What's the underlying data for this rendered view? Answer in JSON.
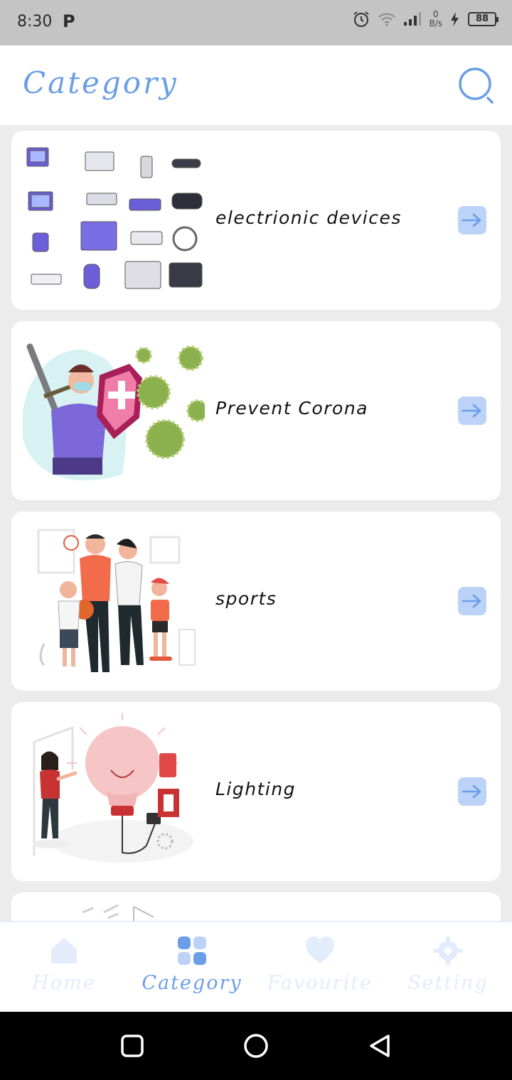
{
  "status_bar": {
    "time": "8:30",
    "app_glyph": "P",
    "net_speed_value": "0",
    "net_speed_unit": "B/s",
    "battery": "88"
  },
  "header": {
    "title": "Category",
    "search_icon": "search-icon"
  },
  "categories": [
    {
      "label": "electrionic devices",
      "illustration": "electronic-devices-illustration",
      "arrow_icon": "arrow-right-icon"
    },
    {
      "label": "Prevent Corona",
      "illustration": "prevent-corona-illustration",
      "arrow_icon": "arrow-right-icon"
    },
    {
      "label": "sports",
      "illustration": "sports-family-illustration",
      "arrow_icon": "arrow-right-icon"
    },
    {
      "label": "Lighting",
      "illustration": "lighting-bulb-illustration",
      "arrow_icon": "arrow-right-icon"
    }
  ],
  "bottom_nav": {
    "items": [
      {
        "label": "Home",
        "icon": "home-icon",
        "active": false
      },
      {
        "label": "Category",
        "icon": "grid-icon",
        "active": true
      },
      {
        "label": "Favourite",
        "icon": "heart-icon",
        "active": false
      },
      {
        "label": "Setting",
        "icon": "gear-icon",
        "active": false
      }
    ]
  },
  "colors": {
    "accent": "#6a9ee8",
    "arrow_bg": "#bcd3f7",
    "inactive_nav": "#e3ecfb"
  }
}
